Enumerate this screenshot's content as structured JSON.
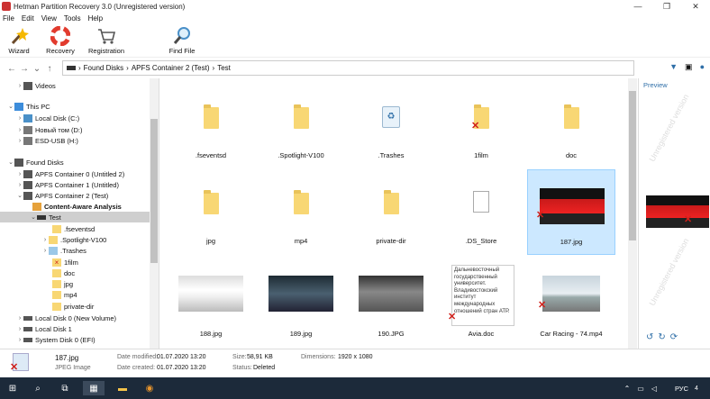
{
  "window": {
    "title": "Hetman Partition Recovery 3.0 (Unregistered version)",
    "controls": [
      "—",
      "❐",
      "✕"
    ]
  },
  "menu": [
    "File",
    "Edit",
    "View",
    "Tools",
    "Help"
  ],
  "toolbar": [
    {
      "label": "Wizard",
      "icon": "wizard-wand-icon"
    },
    {
      "label": "Recovery",
      "icon": "lifebuoy-icon"
    },
    {
      "label": "Registration",
      "icon": "cart-icon"
    },
    {
      "label": "Find File",
      "icon": "magnifier-icon"
    }
  ],
  "address": {
    "segments": [
      "Found Disks",
      "APFS Container 2 (Test)",
      "Test"
    ]
  },
  "tree": [
    {
      "label": "Videos",
      "exp": "›"
    },
    {
      "label": "This PC",
      "exp": "⌄"
    },
    {
      "label": "Local Disk (C:)",
      "exp": "›"
    },
    {
      "label": "Новый том (D:)",
      "exp": "›"
    },
    {
      "label": "ESD-USB (H:)",
      "exp": "›"
    },
    {
      "label": "Found Disks",
      "exp": "⌄"
    },
    {
      "label": "APFS Container 0 (Untitled 2)",
      "exp": "›"
    },
    {
      "label": "APFS Container 1 (Untitled)",
      "exp": "›"
    },
    {
      "label": "APFS Container 2 (Test)",
      "exp": "⌄"
    },
    {
      "label": "Content-Aware Analysis",
      "exp": ""
    },
    {
      "label": "Test",
      "exp": "⌄"
    },
    {
      "label": ".fseventsd",
      "exp": ""
    },
    {
      "label": ".Spotlight-V100",
      "exp": "›"
    },
    {
      "label": ".Trashes",
      "exp": "›"
    },
    {
      "label": "1film",
      "exp": ""
    },
    {
      "label": "doc",
      "exp": ""
    },
    {
      "label": "jpg",
      "exp": ""
    },
    {
      "label": "mp4",
      "exp": ""
    },
    {
      "label": "private-dir",
      "exp": ""
    },
    {
      "label": "Local Disk 0 (New Volume)",
      "exp": "›"
    },
    {
      "label": "Local Disk 1",
      "exp": "›"
    },
    {
      "label": "System Disk 0 (EFI)",
      "exp": "›"
    }
  ],
  "files": [
    {
      "name": ".fseventsd",
      "kind": "folder"
    },
    {
      "name": ".Spotlight-V100",
      "kind": "folder"
    },
    {
      "name": ".Trashes",
      "kind": "trash"
    },
    {
      "name": "1film",
      "kind": "folder-deleted"
    },
    {
      "name": "doc",
      "kind": "folder"
    },
    {
      "name": "jpg",
      "kind": "folder"
    },
    {
      "name": "mp4",
      "kind": "folder"
    },
    {
      "name": "private-dir",
      "kind": "folder"
    },
    {
      "name": ".DS_Store",
      "kind": "file"
    },
    {
      "name": "187.jpg",
      "kind": "image-red-car"
    },
    {
      "name": "188.jpg",
      "kind": "image-white-car"
    },
    {
      "name": "189.jpg",
      "kind": "image-dark-car"
    },
    {
      "name": "190.JPG",
      "kind": "image-grey-car"
    },
    {
      "name": "Avia.doc",
      "kind": "doc-text"
    },
    {
      "name": "Car Racing - 74.mp4",
      "kind": "video-race"
    }
  ],
  "doc_preview_text": "Дальневосточный государственный университет. Владивостокский институт международных отношений стран АТР.",
  "preview": {
    "title": "Preview",
    "watermark": "Unregistered version"
  },
  "status": {
    "filename": "187.jpg",
    "filetype": "JPEG Image",
    "date_modified_label": "Date modified:",
    "date_modified": "01.07.2020 13:20",
    "date_created_label": "Date created:",
    "date_created": "01.07.2020 13:20",
    "size_label": "Size:",
    "size": "58,91 KB",
    "status_label": "Status:",
    "status_value": "Deleted",
    "dimensions_label": "Dimensions:",
    "dimensions": "1920 x 1080"
  },
  "taskbar": {
    "lang": "РУС",
    "notif_count": "4"
  }
}
